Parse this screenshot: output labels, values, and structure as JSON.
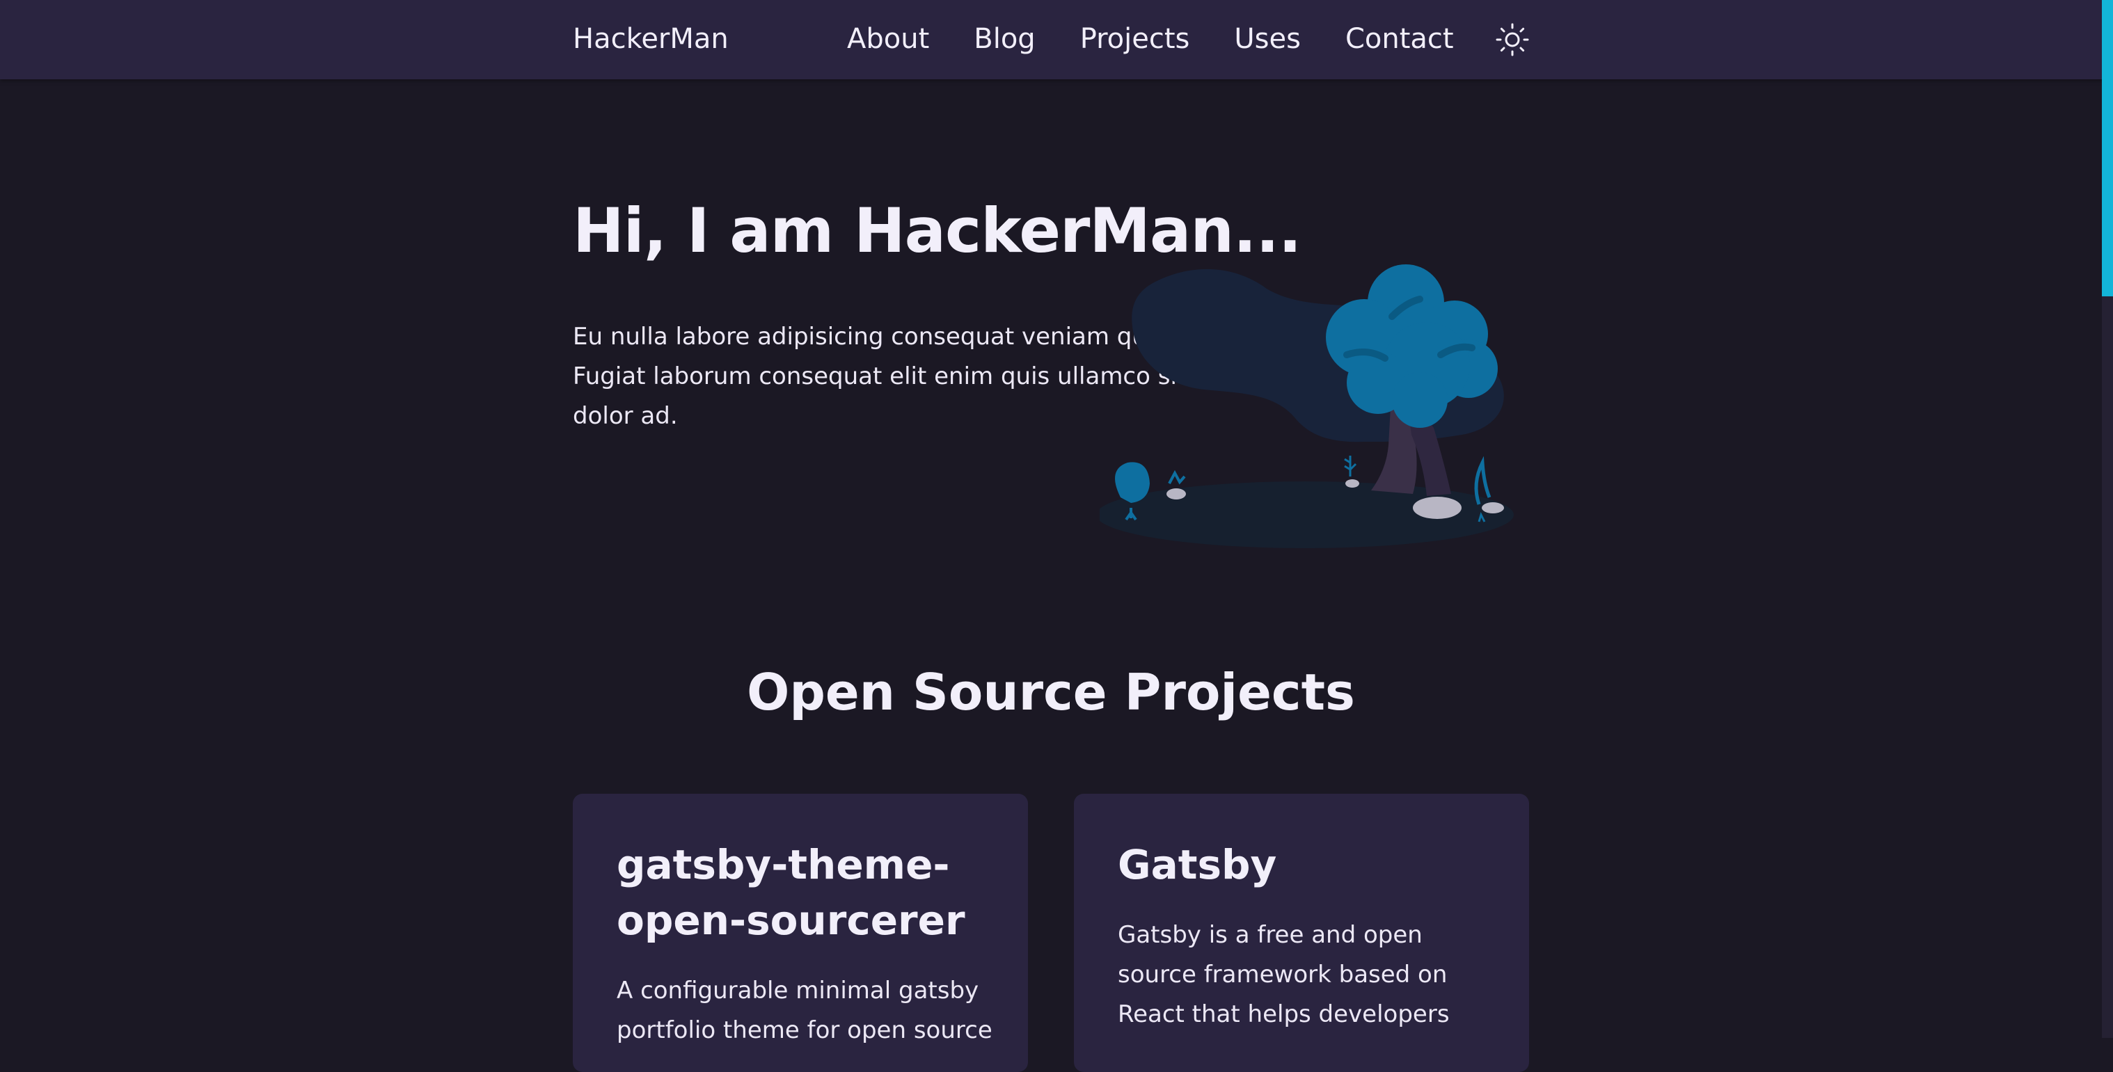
{
  "header": {
    "brand": "HackerMan",
    "nav": [
      {
        "label": "About"
      },
      {
        "label": "Blog"
      },
      {
        "label": "Projects"
      },
      {
        "label": "Uses"
      },
      {
        "label": "Contact"
      }
    ],
    "theme_toggle_icon": "sun-icon"
  },
  "hero": {
    "title": "Hi, I am HackerMan...",
    "text": "Eu nulla labore adipisicing consequat veniam qui ullamco. Fugiat laborum consequat elit enim quis ullamco sit minim dolor ad."
  },
  "projects": {
    "title": "Open Source Projects",
    "items": [
      {
        "title": "gatsby-theme-open-sourcerer",
        "description": "A configurable minimal gatsby portfolio theme for open source"
      },
      {
        "title": "Gatsby",
        "description": "Gatsby is a free and open source framework based on React that helps developers"
      }
    ]
  },
  "colors": {
    "background": "#1b1824",
    "surface": "#2a2440",
    "accent": "#13b5d8",
    "illustration_blue": "#0e6fa0"
  }
}
